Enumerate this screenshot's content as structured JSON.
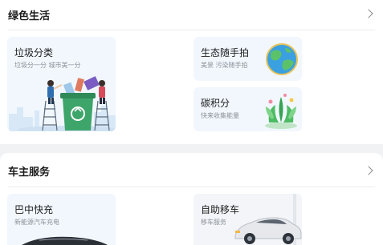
{
  "green_life": {
    "title": "绿色生活",
    "cards": [
      {
        "title": "垃圾分类",
        "subtitle": "垃圾分一分 城市美一分",
        "icon": "garbage-sorting-illustration"
      },
      {
        "title": "生态随手拍",
        "subtitle": "美景 污染随手拍",
        "icon": "earth-globe-icon"
      },
      {
        "title": "碳积分",
        "subtitle": "快来收集能量",
        "icon": "plant-globe-icon"
      }
    ]
  },
  "car_service": {
    "title": "车主服务",
    "cards": [
      {
        "title": "巴中快充",
        "subtitle": "新能源汽车充电",
        "icon": "car-illustration"
      },
      {
        "title": "自助移车",
        "subtitle": "移车服务",
        "icon": "car-illustration"
      }
    ]
  },
  "colors": {
    "card_bg": "#f1f7fd",
    "bin_green": "#3ea56a",
    "page_bg": "#f1f2f4"
  }
}
